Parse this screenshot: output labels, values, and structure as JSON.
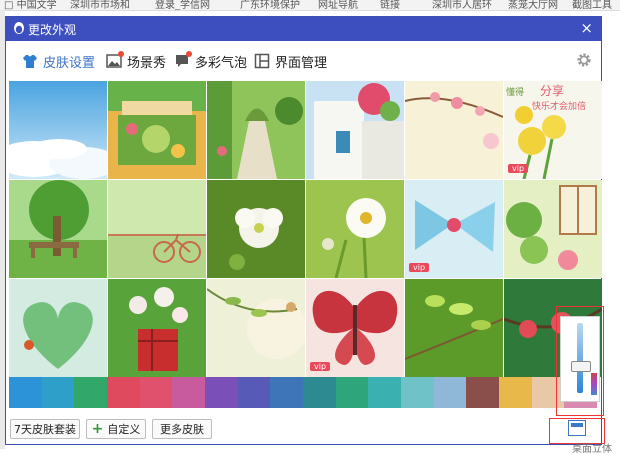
{
  "window": {
    "title": "更改外观",
    "close": "×"
  },
  "tabs": [
    {
      "label": "皮肤设置",
      "icon": "shirt-icon",
      "active": true
    },
    {
      "label": "场景秀",
      "icon": "picture-icon",
      "active": false
    },
    {
      "label": "多彩气泡",
      "icon": "bubble-icon",
      "active": false
    },
    {
      "label": "界面管理",
      "icon": "layout-icon",
      "active": false
    }
  ],
  "tiles": [
    {
      "theme": "sky-clouds"
    },
    {
      "theme": "flower-cart"
    },
    {
      "theme": "garden-arch"
    },
    {
      "theme": "white-stairs"
    },
    {
      "theme": "pink-blossom"
    },
    {
      "theme": "yellow-daisies",
      "text_1": "懂得",
      "text_2": "分享",
      "text_3": "快乐才会加倍",
      "badge": "vip"
    },
    {
      "theme": "tree-bench"
    },
    {
      "theme": "green-bicycle"
    },
    {
      "theme": "white-flower"
    },
    {
      "theme": "cosmos-flower"
    },
    {
      "theme": "blue-bow",
      "badge": "vip"
    },
    {
      "theme": "green-window"
    },
    {
      "theme": "heart-leaf"
    },
    {
      "theme": "flower-pot"
    },
    {
      "theme": "sun-branch"
    },
    {
      "theme": "butterfly",
      "badge": "vip"
    },
    {
      "theme": "green-buds"
    },
    {
      "theme": "red-blossom"
    }
  ],
  "colors": [
    "#2d93d8",
    "#2e9fc8",
    "#31a86a",
    "#e04a5e",
    "#e0516e",
    "#c85a9e",
    "#7b4fb8",
    "#585ab8",
    "#3d75b8",
    "#2c8a90",
    "#2ea57a",
    "#3ab0b0",
    "#6fc3c8",
    "#8fb8d8",
    "#8a4f4a",
    "#e8b94a",
    "#e9c8a8",
    "#d88ab0"
  ],
  "buttons": {
    "suit": "7天皮肤套装",
    "custom": "自定义",
    "more": "更多皮肤"
  },
  "background_bookmarks": [
    "□ 中国文学",
    "深圳市市场和",
    "登录_学信网",
    "广东环境保护",
    "网址导航",
    "链接",
    "深圳市人居环",
    "蒸笼大厅网",
    "截图工具"
  ],
  "background_footer": "桌面立体"
}
